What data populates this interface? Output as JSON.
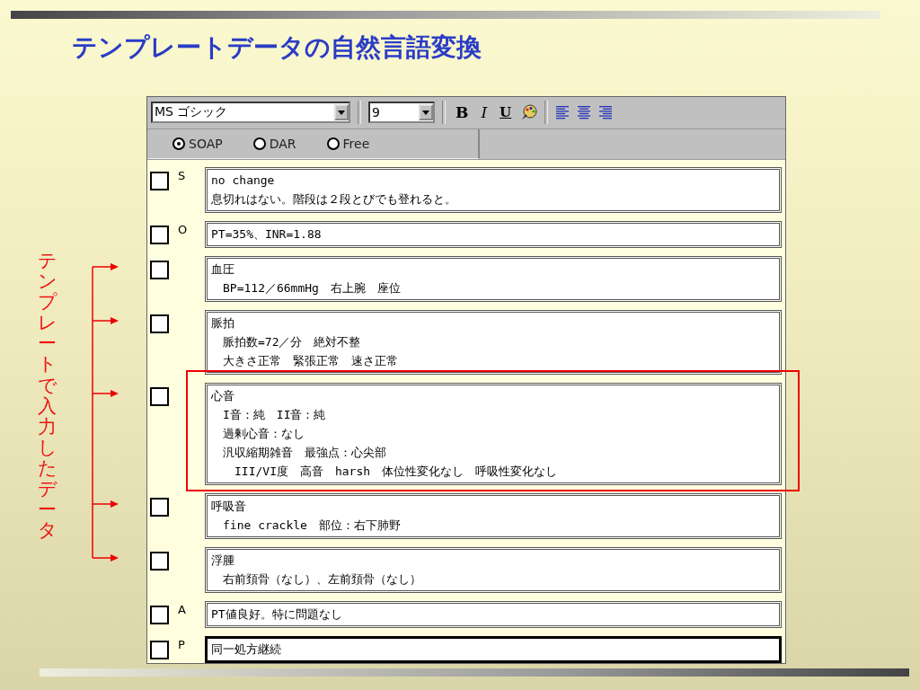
{
  "slide": {
    "title": "テンプレートデータの自然言語変換",
    "annotation": "テンプレートで入力したデータ"
  },
  "toolbar": {
    "font": "MS ゴシック",
    "size": "9",
    "format_buttons": [
      "B",
      "I",
      "U"
    ]
  },
  "note_types": [
    {
      "label": "SOAP",
      "selected": true
    },
    {
      "label": "DAR",
      "selected": false
    },
    {
      "label": "Free",
      "selected": false
    }
  ],
  "entries": [
    {
      "letter": "S",
      "checked": false,
      "focused": false,
      "arrow": false,
      "highlighted": false,
      "lines": [
        "no change",
        "息切れはない。階段は２段とびでも登れると。"
      ]
    },
    {
      "letter": "O",
      "checked": false,
      "focused": false,
      "arrow": false,
      "highlighted": false,
      "lines": [
        "PT=35%、INR=1.88"
      ]
    },
    {
      "checked": false,
      "focused": false,
      "arrow": true,
      "highlighted": false,
      "lines": [
        "血圧",
        "　BP=112／66mmHg　右上腕　座位"
      ]
    },
    {
      "checked": false,
      "focused": false,
      "arrow": true,
      "highlighted": false,
      "lines": [
        "脈拍",
        "　脈拍数=72／分　絶対不整",
        "　大きさ正常　緊張正常　速さ正常"
      ]
    },
    {
      "checked": false,
      "focused": false,
      "arrow": true,
      "highlighted": true,
      "lines": [
        "心音",
        "　I音：純　II音：純",
        "　過剰心音：なし",
        "　汎収縮期雑音　最強点：心尖部",
        "　　III/VI度　高音　harsh　体位性変化なし　呼吸性変化なし"
      ]
    },
    {
      "checked": false,
      "focused": false,
      "arrow": true,
      "highlighted": false,
      "lines": [
        "呼吸音",
        "　fine crackle　部位：右下肺野"
      ]
    },
    {
      "checked": false,
      "focused": false,
      "arrow": true,
      "highlighted": false,
      "lines": [
        "浮腫",
        "　右前頚骨（なし）、左前頚骨（なし）"
      ]
    },
    {
      "letter": "A",
      "checked": false,
      "focused": false,
      "arrow": false,
      "highlighted": false,
      "lines": [
        "PT値良好。特に問題なし"
      ]
    },
    {
      "letter": "P",
      "checked": false,
      "focused": true,
      "arrow": false,
      "highlighted": false,
      "lines": [
        "同一処方継続"
      ]
    }
  ]
}
